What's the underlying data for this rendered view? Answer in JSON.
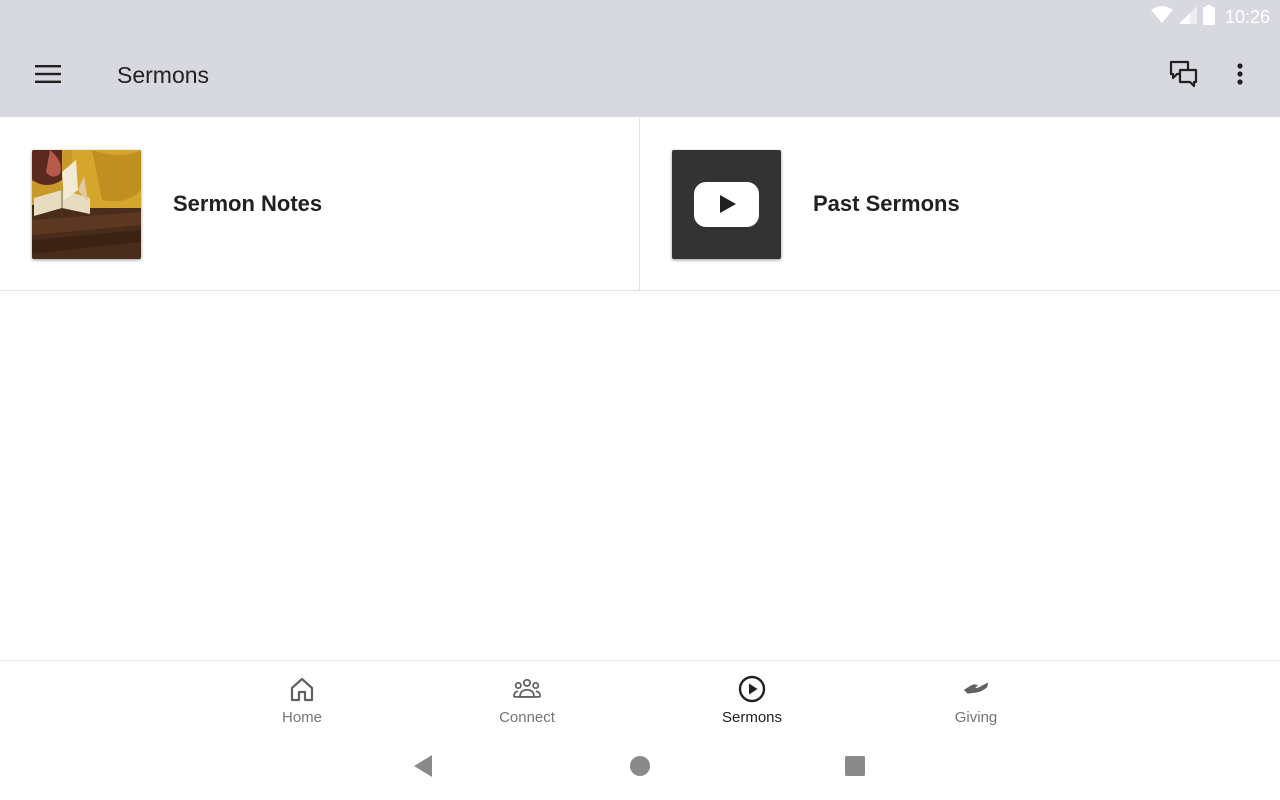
{
  "status_bar": {
    "time": "10:26",
    "icons": [
      "wifi-icon",
      "cell-signal-icon",
      "battery-icon"
    ]
  },
  "app_bar": {
    "title": "Sermons",
    "icons": [
      "hamburger-menu-icon",
      "chat-icon",
      "more-vert-icon"
    ]
  },
  "tiles": [
    {
      "label": "Sermon Notes",
      "thumbnail": "bible-reading-photo"
    },
    {
      "label": "Past Sermons",
      "thumbnail": "youtube-play-icon"
    }
  ],
  "bottom_nav": {
    "items": [
      {
        "label": "Home",
        "icon": "home-icon",
        "active": false
      },
      {
        "label": "Connect",
        "icon": "people-group-icon",
        "active": false
      },
      {
        "label": "Sermons",
        "icon": "play-circle-icon",
        "active": true
      },
      {
        "label": "Giving",
        "icon": "giving-hand-icon",
        "active": false
      }
    ]
  },
  "system_nav": {
    "icons": [
      "back-icon",
      "home-circle-icon",
      "recents-icon"
    ]
  },
  "colors": {
    "header_bg": "#d7d8e0",
    "text_primary": "#212121",
    "text_secondary": "#757575",
    "youtube_tile_bg": "#333333"
  }
}
